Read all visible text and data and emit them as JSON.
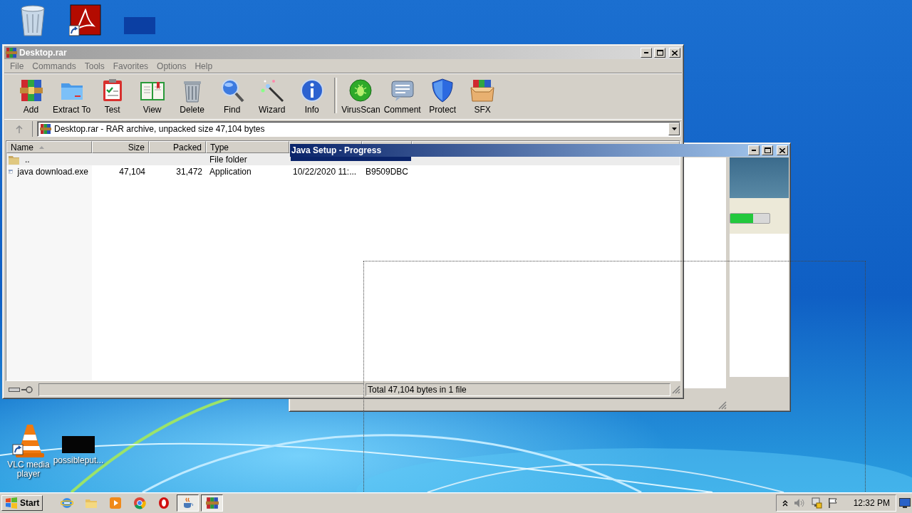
{
  "desktop": {
    "icons": [
      {
        "kind": "recycle-bin"
      },
      {
        "kind": "pdf-shortcut"
      },
      {
        "kind": "blank"
      },
      {
        "kind": "vlc-shortcut",
        "label": "VLC media player"
      },
      {
        "kind": "black-file",
        "label": "possibleput..."
      }
    ]
  },
  "winrar": {
    "title": "Desktop.rar",
    "menu": [
      "File",
      "Commands",
      "Tools",
      "Favorites",
      "Options",
      "Help"
    ],
    "toolbar": [
      [
        {
          "kind": "add",
          "label": "Add"
        },
        {
          "kind": "extract",
          "label": "Extract To"
        },
        {
          "kind": "test",
          "label": "Test"
        },
        {
          "kind": "view",
          "label": "View"
        },
        {
          "kind": "delete",
          "label": "Delete"
        },
        {
          "kind": "find",
          "label": "Find"
        },
        {
          "kind": "wizard",
          "label": "Wizard"
        },
        {
          "kind": "info",
          "label": "Info"
        }
      ],
      [
        {
          "kind": "virusscan",
          "label": "VirusScan"
        },
        {
          "kind": "comment",
          "label": "Comment"
        },
        {
          "kind": "protect",
          "label": "Protect"
        },
        {
          "kind": "sfx",
          "label": "SFX"
        }
      ]
    ],
    "address": "Desktop.rar - RAR archive, unpacked size 47,104 bytes",
    "columns": [
      {
        "label": "Name",
        "sorted": true
      },
      {
        "label": "Size",
        "sorted": false
      },
      {
        "label": "Packed",
        "sorted": false
      },
      {
        "label": "Type",
        "sorted": false
      }
    ],
    "rows": [
      {
        "kind": "folder",
        "name": "..",
        "type": "File folder",
        "selected": true
      },
      {
        "kind": "exe",
        "name": "java download.exe",
        "size": "47,104",
        "packed": "31,472",
        "type": "Application",
        "modified": "10/22/2020 11:...",
        "crc": "B9509DBC",
        "selected": false
      }
    ],
    "status": "Total 47,104 bytes in 1 file"
  },
  "java_setup": {
    "title": "Java Setup - Progress",
    "progress": {
      "level": 0.58
    }
  },
  "taskbar": {
    "start": "Start",
    "apps": [
      {
        "kind": "ie",
        "active": false
      },
      {
        "kind": "explorer",
        "active": false
      },
      {
        "kind": "media",
        "active": false
      },
      {
        "kind": "chrome",
        "active": false
      },
      {
        "kind": "opera",
        "active": false
      },
      {
        "kind": "java",
        "active": true
      },
      {
        "kind": "winrar",
        "active": true
      }
    ],
    "clock": "12:32 PM"
  }
}
